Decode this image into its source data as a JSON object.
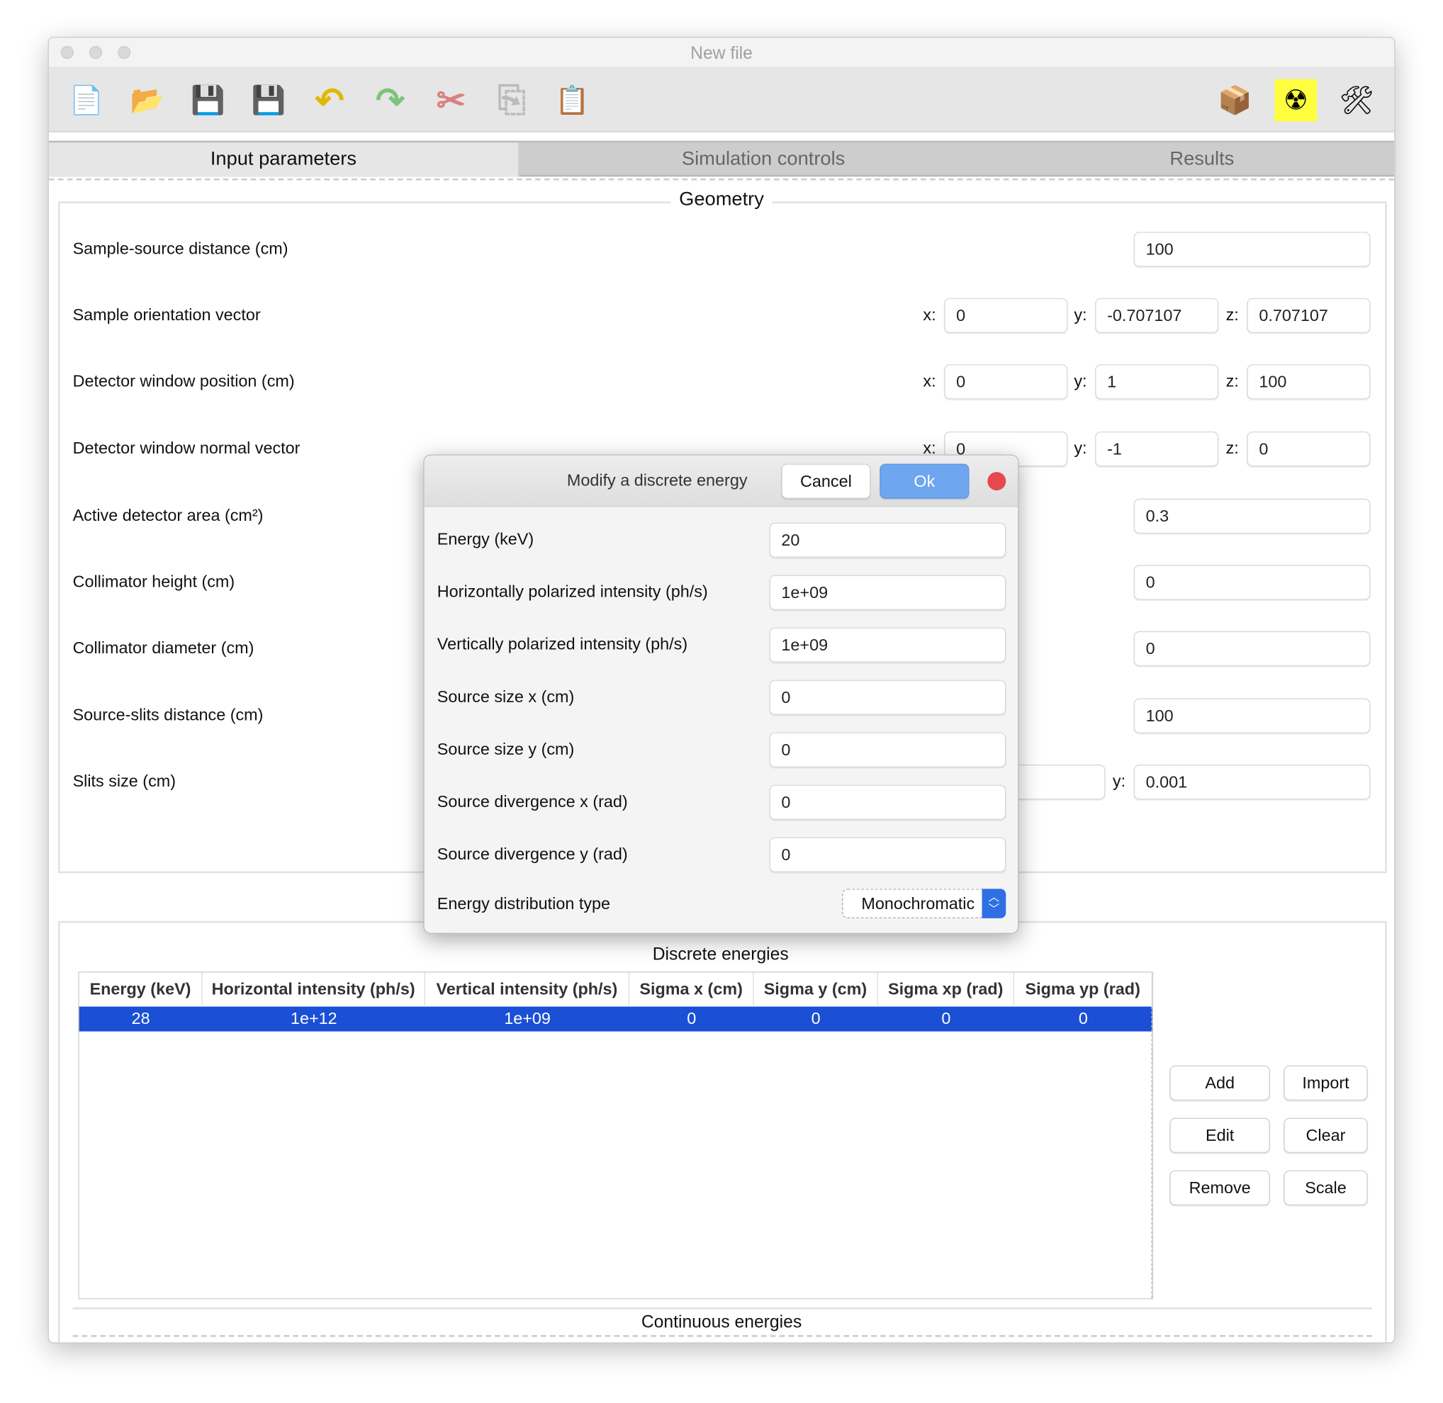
{
  "window": {
    "title": "New file"
  },
  "toolbar": {
    "left": [
      {
        "name": "new-file-icon",
        "glyph": "📄"
      },
      {
        "name": "open-folder-icon",
        "glyph": "📂"
      },
      {
        "name": "save-icon",
        "glyph": "💾"
      },
      {
        "name": "save-as-icon",
        "glyph": "💾"
      },
      {
        "name": "undo-icon",
        "glyph": "↶",
        "color": "#e0b800"
      },
      {
        "name": "redo-icon",
        "glyph": "↷",
        "color": "#7cc47c"
      },
      {
        "name": "cut-icon",
        "glyph": "✂",
        "color": "#d98080"
      },
      {
        "name": "copy-icon",
        "glyph": "⎘",
        "color": "#bbb"
      },
      {
        "name": "paste-icon",
        "glyph": "📋"
      }
    ],
    "right": [
      {
        "name": "package-icon",
        "glyph": "📦"
      },
      {
        "name": "radiation-icon",
        "glyph": "☢",
        "bg": "#ffff40"
      },
      {
        "name": "tools-icon",
        "glyph": "🛠"
      }
    ]
  },
  "tabs": [
    {
      "label": "Input parameters",
      "active": true
    },
    {
      "label": "Simulation controls"
    },
    {
      "label": "Results"
    }
  ],
  "geometry": {
    "title": "Geometry",
    "rows": [
      {
        "label": "Sample-source distance (cm)",
        "value": "100"
      },
      {
        "label": "Sample orientation vector",
        "x": "0",
        "y": "-0.707107",
        "z": "0.707107"
      },
      {
        "label": "Detector window position (cm)",
        "x": "0",
        "y": "1",
        "z": "100"
      },
      {
        "label": "Detector window normal vector",
        "x": "0",
        "y": "-1",
        "z": "0"
      },
      {
        "label": "Active detector area (cm²)",
        "value": "0.3"
      },
      {
        "label": "Collimator height (cm)",
        "value": "0"
      },
      {
        "label": "Collimator diameter (cm)",
        "value": "0"
      },
      {
        "label": "Source-slits distance (cm)",
        "value": "100"
      },
      {
        "label": "Slits size (cm)",
        "xy": true,
        "y": "0.001"
      }
    ]
  },
  "axis_labels": {
    "x": "x:",
    "y": "y:",
    "z": "z:"
  },
  "dialog": {
    "title": "Modify a discrete energy",
    "cancel": "Cancel",
    "ok": "Ok",
    "fields": [
      {
        "label": "Energy (keV)",
        "value": "20"
      },
      {
        "label": "Horizontally polarized intensity (ph/s)",
        "value": "1e+09"
      },
      {
        "label": "Vertically polarized intensity (ph/s)",
        "value": "1e+09"
      },
      {
        "label": "Source size x (cm)",
        "value": "0"
      },
      {
        "label": "Source size y (cm)",
        "value": "0"
      },
      {
        "label": "Source divergence x (rad)",
        "value": "0"
      },
      {
        "label": "Source divergence y (rad)",
        "value": "0"
      }
    ],
    "dist_label": "Energy distribution type",
    "dist_value": "Monochromatic",
    "accent": "#2f6fe6"
  },
  "energies": {
    "title": "Discrete energies",
    "columns": [
      "Energy (keV)",
      "Horizontal intensity (ph/s)",
      "Vertical intensity (ph/s)",
      "Sigma x (cm)",
      "Sigma y (cm)",
      "Sigma xp (rad)",
      "Sigma yp (rad)"
    ],
    "rows": [
      [
        "28",
        "1e+12",
        "1e+09",
        "0",
        "0",
        "0",
        "0"
      ]
    ],
    "selected_color": "#1a4fd6",
    "buttons": [
      "Add",
      "Import",
      "Edit",
      "Clear",
      "Remove",
      "Scale"
    ],
    "continuous_title": "Continuous energies"
  }
}
